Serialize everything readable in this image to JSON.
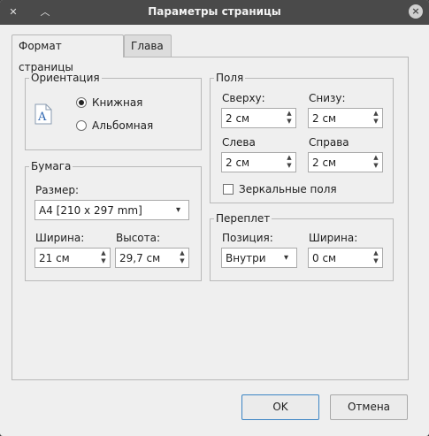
{
  "window": {
    "title": "Параметры страницы"
  },
  "tabs": [
    {
      "label": "Формат страницы"
    },
    {
      "label": "Глава"
    }
  ],
  "orientation": {
    "title": "Ориентация",
    "portrait_label": "Книжная",
    "landscape_label": "Альбомная",
    "selected": "portrait"
  },
  "paper": {
    "title": "Бумага",
    "size_label": "Размер:",
    "size_value": "A4 [210 x 297 mm]",
    "width_label": "Ширина:",
    "width_value": "21 см",
    "height_label": "Высота:",
    "height_value": "29,7 см"
  },
  "margins": {
    "title": "Поля",
    "top_label": "Сверху:",
    "top_value": "2 см",
    "bottom_label": "Снизу:",
    "bottom_value": "2 см",
    "left_label": "Слева",
    "left_value": "2 см",
    "right_label": "Справа",
    "right_value": "2 см",
    "mirror_label": "Зеркальные поля",
    "mirror_checked": false
  },
  "binding": {
    "title": "Переплет",
    "position_label": "Позиция:",
    "position_value": "Внутри",
    "width_label": "Ширина:",
    "width_value": "0 см"
  },
  "buttons": {
    "ok": "OK",
    "cancel": "Отмена"
  },
  "icons": {
    "close": "close-icon",
    "menu": "window-menu-icon",
    "collapse": "chevron-up-icon",
    "page": "page-portrait-icon"
  },
  "colors": {
    "titlebar": "#4a4a4a",
    "accent": "#3b84c4"
  }
}
